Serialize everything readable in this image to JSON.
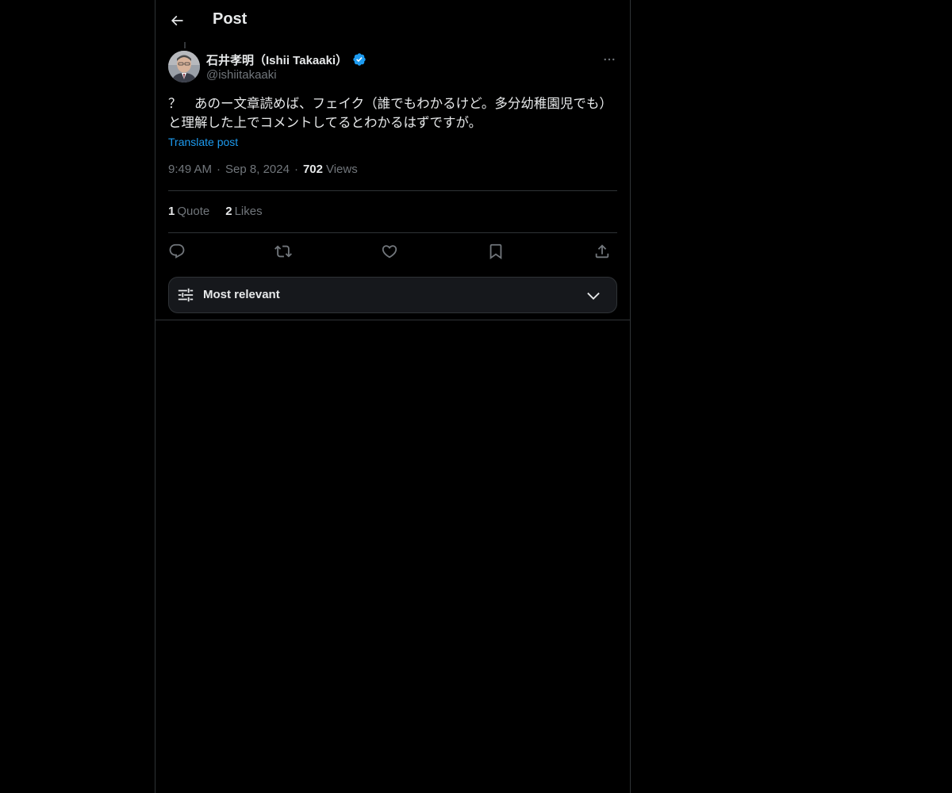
{
  "header": {
    "title": "Post",
    "back_icon": "arrow-left-icon"
  },
  "post": {
    "author": {
      "name": "石井孝明（Ishii Takaaki）",
      "handle": "@ishiitakaaki",
      "verified": true,
      "verified_color": "#1d9bf0"
    },
    "text": "？　あのー文章読めば、フェイク（誰でもわかるけど。多分幼稚園児でも）と理解した上でコメントしてるとわかるはずですが。",
    "translate_label": "Translate post",
    "time": "9:49 AM",
    "date": "Sep 8, 2024",
    "views_count": "702",
    "views_label": "Views"
  },
  "stats": {
    "quote_count": "1",
    "quote_label": "Quote",
    "likes_count": "2",
    "likes_label": "Likes"
  },
  "actions": {
    "reply_icon": "reply-icon",
    "repost_icon": "repost-icon",
    "like_icon": "heart-icon",
    "bookmark_icon": "bookmark-icon",
    "share_icon": "share-icon"
  },
  "sort": {
    "label": "Most relevant",
    "icon": "sliders-icon",
    "chevron": "chevron-down-icon"
  },
  "colors": {
    "background": "#000000",
    "text_primary": "#e7e9ea",
    "text_secondary": "#71767b",
    "accent": "#1d9bf0",
    "border": "#2f3336"
  }
}
